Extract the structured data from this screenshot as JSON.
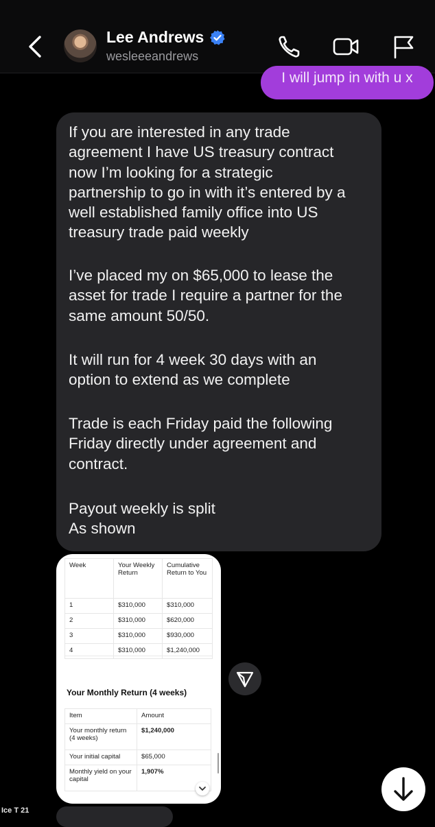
{
  "header": {
    "name": "Lee Andrews",
    "handle": "wesleeeandrews"
  },
  "messages": {
    "sent": "I will jump in with u x",
    "received_paragraphs": [
      "If you are interested in any trade\nagreement I have US treasury contract\nnow I’m looking for a strategic\npartnership to go in with it’s entered by a\nwell established family office into US\ntreasury trade paid weekly",
      "I’ve placed my on $65,000 to lease the\nasset for trade I require a partner for the\nsame amount 50/50.",
      "It will run for 4 week 30 days with an\noption to extend as we complete",
      "Trade is each Friday paid the following\nFriday directly under agreement and\ncontract.",
      "Payout weekly is split\nAs shown"
    ]
  },
  "attachment": {
    "weekly_table": {
      "headers": [
        "Week",
        "Your Weekly Return",
        "Cumulative Return to You"
      ],
      "rows": [
        [
          "1",
          "$310,000",
          "$310,000"
        ],
        [
          "2",
          "$310,000",
          "$620,000"
        ],
        [
          "3",
          "$310,000",
          "$930,000"
        ],
        [
          "4",
          "$310,000",
          "$1,240,000"
        ]
      ]
    },
    "monthly_title": "Your Monthly Return (4 weeks)",
    "monthly_table": {
      "headers": [
        "Item",
        "Amount"
      ],
      "rows": [
        [
          "Your monthly return (4 weeks)",
          "$1,240,000"
        ],
        [
          "Your initial capital",
          "$65,000"
        ],
        [
          "Monthly yield on your capital",
          "1,907%"
        ]
      ]
    }
  },
  "watermark": "Ice T 21",
  "colors": {
    "sent_bubble": "#a23ddb",
    "received_bubble": "#262629",
    "verified": "#3b82f6"
  },
  "icons": [
    "back-arrow-icon",
    "verified-badge-icon",
    "phone-icon",
    "video-icon",
    "flag-icon",
    "share-icon",
    "chevron-down-icon",
    "arrow-down-icon"
  ]
}
